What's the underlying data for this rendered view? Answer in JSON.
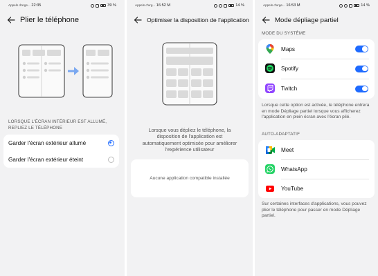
{
  "panels": [
    {
      "status": {
        "carrier": "Appels d'urge...",
        "time": "22:35",
        "battery": "39 %"
      },
      "title": "Plier le téléphone",
      "section": "LORSQUE L'ÉCRAN INTÉRIEUR EST ALLUMÉ, REPLIEZ LE TÉLÉPHONE",
      "options": [
        {
          "label": "Garder l'écran extérieur allumé",
          "selected": true
        },
        {
          "label": "Garder l'écran extérieur éteint",
          "selected": false
        }
      ]
    },
    {
      "status": {
        "carrier": "Appels d'urg...",
        "time": "16:52 M",
        "battery": "14 %"
      },
      "title": "Optimiser la disposition de l'application",
      "description": "Lorsque vous dépliez le téléphone, la disposition de l'application est automatiquement optimisée pour améliorer l'expérience utilisateur",
      "empty_text": "Aucune application compatible installée"
    },
    {
      "status": {
        "carrier": "Appels d'urge...",
        "time": "16:53 M",
        "battery": "14 %"
      },
      "title": "Mode dépliage partiel",
      "section_system": "MODE DU SYSTÈME",
      "system_apps": [
        {
          "name": "Maps",
          "icon": "maps-icon",
          "enabled": true
        },
        {
          "name": "Spotify",
          "icon": "spotify-icon",
          "enabled": true
        },
        {
          "name": "Twitch",
          "icon": "twitch-icon",
          "enabled": true
        }
      ],
      "system_note": "Lorsque cette option est activée, le téléphone entrera en mode Dépliage partiel lorsque vous afficherez l'application en plein écran avec l'écran plié.",
      "section_auto": "AUTO-ADAPTATIF",
      "auto_apps": [
        {
          "name": "Meet",
          "icon": "meet-icon"
        },
        {
          "name": "WhatsApp",
          "icon": "whatsapp-icon"
        },
        {
          "name": "YouTube",
          "icon": "youtube-icon"
        }
      ],
      "auto_note": "Sur certaines interfaces d'applications, vous pouvez plier le téléphone pour passer en mode Dépliage partiel."
    }
  ],
  "colors": {
    "accent": "#1f6bff",
    "background": "#f2f2f3",
    "card": "#ffffff"
  }
}
